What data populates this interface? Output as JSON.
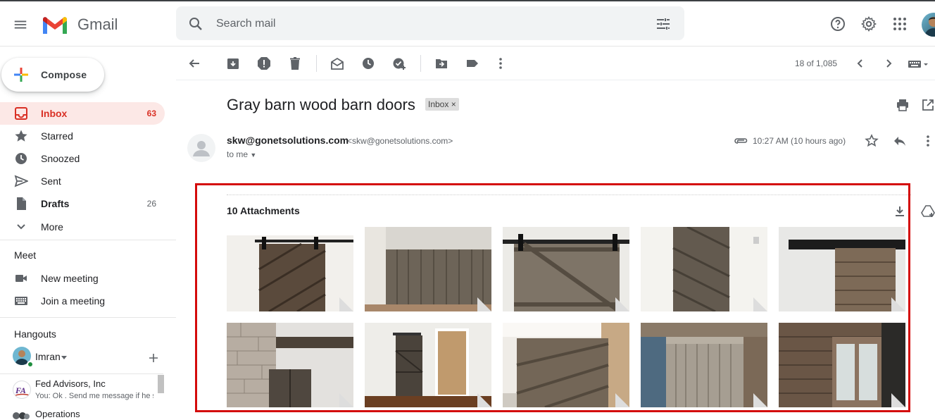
{
  "app": {
    "name": "Gmail"
  },
  "search": {
    "placeholder": "Search mail"
  },
  "compose": {
    "label": "Compose"
  },
  "nav": [
    {
      "label": "Inbox",
      "count": "63",
      "icon": "inbox-icon"
    },
    {
      "label": "Starred",
      "count": "",
      "icon": "star-icon"
    },
    {
      "label": "Snoozed",
      "count": "",
      "icon": "clock-icon"
    },
    {
      "label": "Sent",
      "count": "",
      "icon": "send-icon"
    },
    {
      "label": "Drafts",
      "count": "26",
      "icon": "draft-icon"
    },
    {
      "label": "More",
      "count": "",
      "icon": "chevron-down-icon"
    }
  ],
  "meet": {
    "title": "Meet",
    "items": [
      {
        "label": "New meeting",
        "icon": "video-icon"
      },
      {
        "label": "Join a meeting",
        "icon": "keyboard-icon"
      }
    ]
  },
  "hangouts": {
    "title": "Hangouts",
    "user": "Imran",
    "contacts": [
      {
        "name": "Fed Advisors, Inc",
        "preview": "You: Ok . Send me message if he s"
      },
      {
        "name": "Operations",
        "preview": ""
      }
    ]
  },
  "toolbar": {
    "pager": "18 of 1,085"
  },
  "email": {
    "subject": "Gray barn wood barn doors",
    "label_chip": "Inbox",
    "sender_name": "skw@gonetsolutions.com",
    "sender_email": "<skw@gonetsolutions.com>",
    "to": "to me",
    "time": "10:27 AM (10 hours ago)"
  },
  "attachments": {
    "title": "10 Attachments",
    "count": 10
  },
  "colors": {
    "active_bg": "#fce8e6",
    "active_text": "#d93025",
    "highlight_border": "#d40b0b"
  }
}
